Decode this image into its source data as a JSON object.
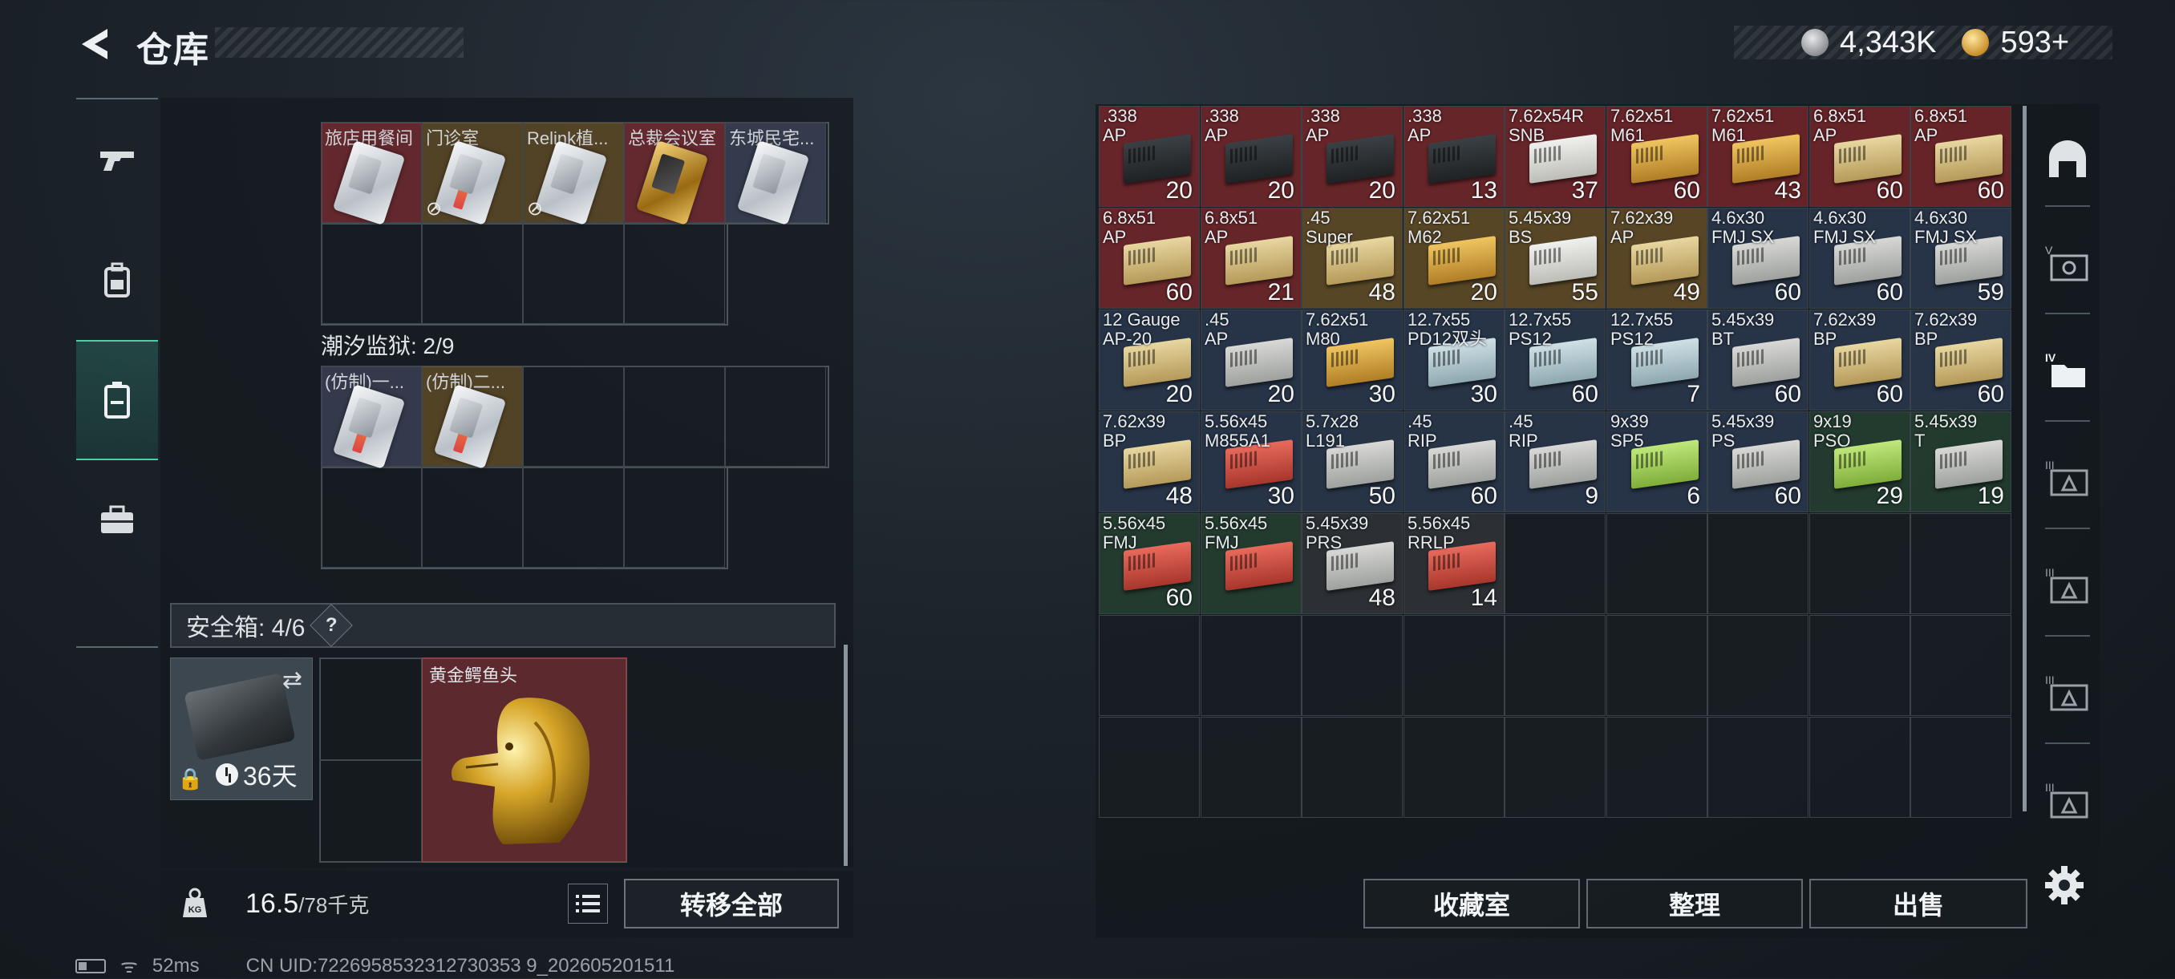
{
  "header": {
    "title": "仓库"
  },
  "currency": {
    "silver": "4,343K",
    "gold": "593+"
  },
  "left_tabs": [
    "weapon-icon",
    "backpack-icon",
    "container-icon",
    "briefcase-icon"
  ],
  "keycards_section": {
    "row1": [
      {
        "name": "旅店用餐间",
        "style": "white",
        "nolink": false
      },
      {
        "name": "门诊室",
        "style": "stripe",
        "nolink": true
      },
      {
        "name": "Relink植...",
        "style": "white",
        "nolink": true
      },
      {
        "name": "总裁会议室",
        "style": "gold",
        "nolink": false
      },
      {
        "name": "东城民宅...",
        "style": "white",
        "nolink": false
      }
    ]
  },
  "prison_section": {
    "label": "潮汐监狱: 2/9",
    "row1": [
      {
        "name": "(仿制)一...",
        "style": "stripe"
      },
      {
        "name": "(仿制)二...",
        "style": "stripe"
      }
    ]
  },
  "safe_box": {
    "label": "安全箱: 4/6",
    "help": "?",
    "days": "36天",
    "item_name": "黄金鳄鱼头"
  },
  "footer_left": {
    "weight": "16.5",
    "weight_max": "/78千克",
    "transfer_all": "转移全部"
  },
  "status": {
    "ping": "52ms",
    "uid": "CN UID:7226958532312730353 9_202605201511"
  },
  "ammo": [
    {
      "cal": ".338\nAP",
      "qty": "20",
      "bg": "red",
      "box": "dark"
    },
    {
      "cal": ".338\nAP",
      "qty": "20",
      "bg": "red",
      "box": "dark"
    },
    {
      "cal": ".338\nAP",
      "qty": "20",
      "bg": "red",
      "box": "dark"
    },
    {
      "cal": ".338\nAP",
      "qty": "13",
      "bg": "red",
      "box": "dark"
    },
    {
      "cal": "7.62x54R\nSNB",
      "qty": "37",
      "bg": "red",
      "box": "white"
    },
    {
      "cal": "7.62x51\nM61",
      "qty": "60",
      "bg": "red",
      "box": "gold"
    },
    {
      "cal": "7.62x51\nM61",
      "qty": "43",
      "bg": "red",
      "box": "gold"
    },
    {
      "cal": "6.8x51\nAP",
      "qty": "60",
      "bg": "red",
      "box": "tan"
    },
    {
      "cal": "6.8x51\nAP",
      "qty": "60",
      "bg": "red",
      "box": "tan"
    },
    {
      "cal": "6.8x51\nAP",
      "qty": "60",
      "bg": "red",
      "box": "tan"
    },
    {
      "cal": "6.8x51\nAP",
      "qty": "21",
      "bg": "red",
      "box": "tan"
    },
    {
      "cal": ".45\nSuper",
      "qty": "48",
      "bg": "gold",
      "box": "tan"
    },
    {
      "cal": "7.62x51\nM62",
      "qty": "20",
      "bg": "gold",
      "box": "gold"
    },
    {
      "cal": "5.45x39\nBS",
      "qty": "55",
      "bg": "gold",
      "box": "white"
    },
    {
      "cal": "7.62x39\nAP",
      "qty": "49",
      "bg": "gold",
      "box": "tan"
    },
    {
      "cal": "4.6x30\nFMJ SX",
      "qty": "60",
      "bg": "blue",
      "box": "grey"
    },
    {
      "cal": "4.6x30\nFMJ SX",
      "qty": "60",
      "bg": "blue",
      "box": "grey"
    },
    {
      "cal": "4.6x30\nFMJ SX",
      "qty": "59",
      "bg": "blue",
      "box": "grey"
    },
    {
      "cal": "12 Gauge\nAP-20",
      "qty": "20",
      "bg": "blue",
      "box": "tan"
    },
    {
      "cal": ".45\nAP",
      "qty": "20",
      "bg": "blue",
      "box": "grey"
    },
    {
      "cal": "7.62x51\nM80",
      "qty": "30",
      "bg": "blue",
      "box": "gold"
    },
    {
      "cal": "12.7x55\nPD12双头",
      "qty": "30",
      "bg": "blue",
      "box": "blue"
    },
    {
      "cal": "12.7x55\nPS12",
      "qty": "60",
      "bg": "blue",
      "box": "blue"
    },
    {
      "cal": "12.7x55\nPS12",
      "qty": "7",
      "bg": "blue",
      "box": "blue"
    },
    {
      "cal": "5.45x39\nBT",
      "qty": "60",
      "bg": "blue",
      "box": "grey"
    },
    {
      "cal": "7.62x39\nBP",
      "qty": "60",
      "bg": "blue",
      "box": "tan"
    },
    {
      "cal": "7.62x39\nBP",
      "qty": "60",
      "bg": "blue",
      "box": "tan"
    },
    {
      "cal": "7.62x39\nBP",
      "qty": "48",
      "bg": "blue",
      "box": "tan"
    },
    {
      "cal": "5.56x45\nM855A1",
      "qty": "30",
      "bg": "blue",
      "box": "red"
    },
    {
      "cal": "5.7x28\nL191",
      "qty": "50",
      "bg": "blue",
      "box": "grey"
    },
    {
      "cal": ".45\nRIP",
      "qty": "60",
      "bg": "blue",
      "box": "grey"
    },
    {
      "cal": ".45\nRIP",
      "qty": "9",
      "bg": "blue",
      "box": "grey"
    },
    {
      "cal": "9x39\nSP5",
      "qty": "6",
      "bg": "blue",
      "box": "lime"
    },
    {
      "cal": "5.45x39\nPS",
      "qty": "60",
      "bg": "blue",
      "box": "grey"
    },
    {
      "cal": "9x19\nPSO",
      "qty": "29",
      "bg": "green",
      "box": "lime"
    },
    {
      "cal": "5.45x39\nT",
      "qty": "19",
      "bg": "green",
      "box": "grey"
    },
    {
      "cal": "5.56x45\nFMJ",
      "qty": "60",
      "bg": "green",
      "box": "red"
    },
    {
      "cal": "5.56x45\nFMJ",
      "qty": "",
      "bg": "green",
      "box": "red"
    },
    {
      "cal": "5.45x39\nPRS",
      "qty": "48",
      "bg": "dark",
      "box": "grey"
    },
    {
      "cal": "5.56x45\nRRLP",
      "qty": "14",
      "bg": "dark",
      "box": "red"
    }
  ],
  "right_tabs": [
    "helmet-icon",
    "vest-icon",
    "folder-icon",
    "storage-3-icon",
    "storage-3b-icon",
    "storage-3c-icon",
    "storage-3d-icon"
  ],
  "footer_right": {
    "collection": "收藏室",
    "sort": "整理",
    "sell": "出售"
  }
}
